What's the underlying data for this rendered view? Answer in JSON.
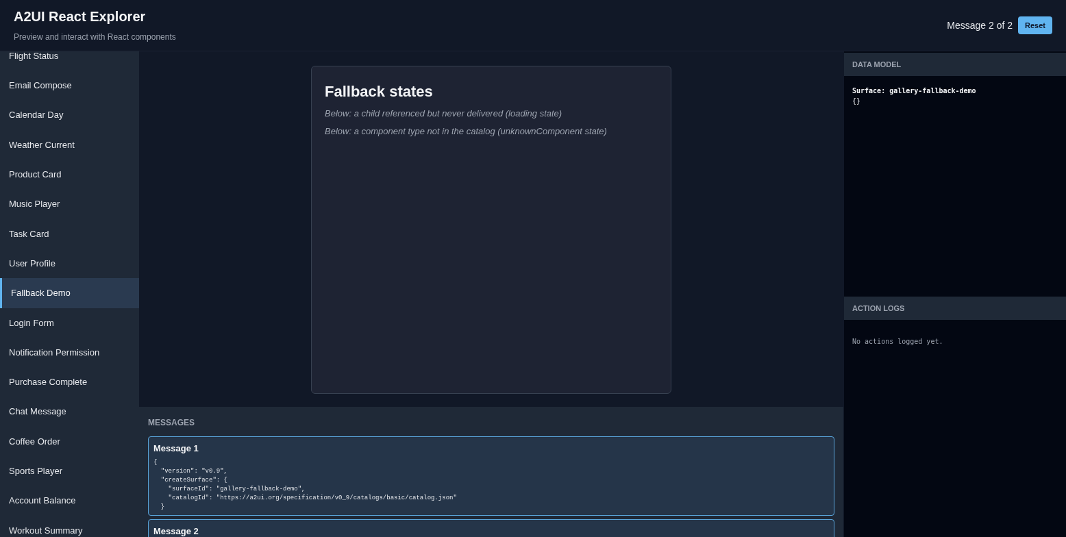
{
  "header": {
    "title": "A2UI React Explorer",
    "subtitle": "Preview and interact with React components",
    "message_counter": "Message 2 of 2",
    "reset_button": "Reset"
  },
  "sidebar": {
    "items": [
      {
        "label": "Flight Status",
        "selected": false
      },
      {
        "label": "Email Compose",
        "selected": false
      },
      {
        "label": "Calendar Day",
        "selected": false
      },
      {
        "label": "Weather Current",
        "selected": false
      },
      {
        "label": "Product Card",
        "selected": false
      },
      {
        "label": "Music Player",
        "selected": false
      },
      {
        "label": "Task Card",
        "selected": false
      },
      {
        "label": "User Profile",
        "selected": false
      },
      {
        "label": "Fallback Demo",
        "selected": true
      },
      {
        "label": "Login Form",
        "selected": false
      },
      {
        "label": "Notification Permission",
        "selected": false
      },
      {
        "label": "Purchase Complete",
        "selected": false
      },
      {
        "label": "Chat Message",
        "selected": false
      },
      {
        "label": "Coffee Order",
        "selected": false
      },
      {
        "label": "Sports Player",
        "selected": false
      },
      {
        "label": "Account Balance",
        "selected": false
      },
      {
        "label": "Workout Summary",
        "selected": false
      }
    ]
  },
  "preview": {
    "title": "Fallback states",
    "notes": [
      "Below: a child referenced but never delivered (loading state)",
      "Below: a component type not in the catalog (unknownComponent state)"
    ]
  },
  "messages": {
    "heading": "MESSAGES",
    "items": [
      {
        "title": "Message 1",
        "code": "{\n  \"version\": \"v0.9\",\n  \"createSurface\": {\n    \"surfaceId\": \"gallery-fallback-demo\",\n    \"catalogId\": \"https://a2ui.org/specification/v0_9/catalogs/basic/catalog.json\"\n  }"
      },
      {
        "title": "Message 2"
      }
    ]
  },
  "data_model": {
    "heading": "DATA MODEL",
    "surface": "Surface: gallery-fallback-demo",
    "value": "{}"
  },
  "action_logs": {
    "heading": "ACTION LOGS",
    "empty_text": "No actions logged yet."
  }
}
